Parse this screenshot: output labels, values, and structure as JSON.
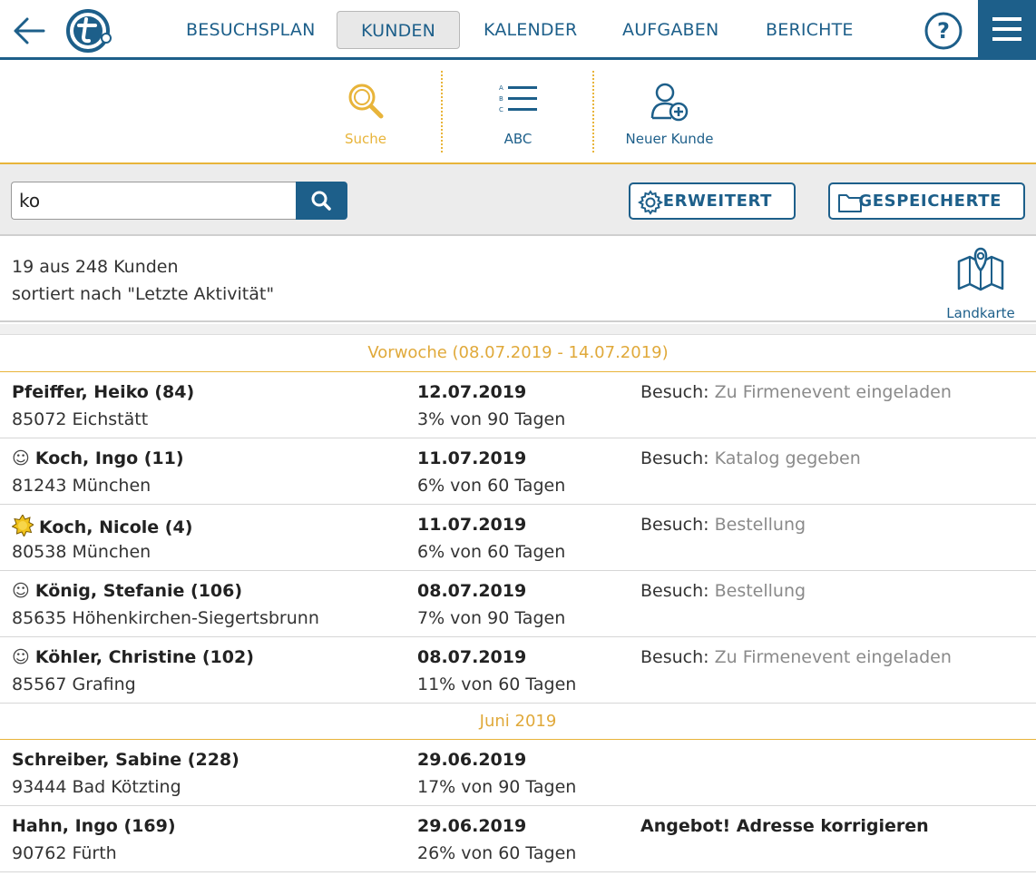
{
  "nav": {
    "items": [
      {
        "label": "BESUCHSPLAN"
      },
      {
        "label": "KUNDEN"
      },
      {
        "label": "KALENDER"
      },
      {
        "label": "AUFGABEN"
      },
      {
        "label": "BERICHTE"
      }
    ],
    "active": "KUNDEN"
  },
  "tools": {
    "search_label": "Suche",
    "abc_label": "ABC",
    "new_label": "Neuer Kunde"
  },
  "search": {
    "value": "ko",
    "advanced_label": "ERWEITERT",
    "saved_label": "GESPEICHERTE"
  },
  "summary": {
    "count_text": "19 aus 248 Kunden",
    "sort_text": "sortiert nach \"Letzte Aktivität\"",
    "map_label": "Landkarte"
  },
  "groups": [
    {
      "header": "Vorwoche (08.07.2019 - 14.07.2019)",
      "rows": [
        {
          "icon": "",
          "name": "Pfeiffer, Heiko (84)",
          "city": "85072 Eichstätt",
          "date": "12.07.2019",
          "ratio": "3% von 90 Tagen",
          "activity_type": "Besuch: ",
          "activity_detail": "Zu Firmenevent eingeladen"
        },
        {
          "icon": "☺",
          "name": "Koch, Ingo (11)",
          "city": "81243 München",
          "date": "11.07.2019",
          "ratio": "6% von 60 Tagen",
          "activity_type": "Besuch: ",
          "activity_detail": "Katalog gegeben"
        },
        {
          "icon": "sun",
          "name": "Koch, Nicole (4)",
          "city": "80538 München",
          "date": "11.07.2019",
          "ratio": "6% von 60 Tagen",
          "activity_type": "Besuch: ",
          "activity_detail": "Bestellung"
        },
        {
          "icon": "☺",
          "name": "König, Stefanie (106)",
          "city": "85635 Höhenkirchen-Siegertsbrunn",
          "date": "08.07.2019",
          "ratio": "7% von 90 Tagen",
          "activity_type": "Besuch: ",
          "activity_detail": "Bestellung"
        },
        {
          "icon": "☺",
          "name": "Köhler, Christine (102)",
          "city": "85567 Grafing",
          "date": "08.07.2019",
          "ratio": "11% von 60 Tagen",
          "activity_type": "Besuch: ",
          "activity_detail": "Zu Firmenevent eingeladen"
        }
      ]
    },
    {
      "header": "Juni 2019",
      "rows": [
        {
          "icon": "",
          "name": "Schreiber, Sabine (228)",
          "city": "93444 Bad Kötzting",
          "date": "29.06.2019",
          "ratio": "17% von 90 Tagen",
          "activity_type": "",
          "activity_detail": ""
        },
        {
          "icon": "",
          "name": "Hahn, Ingo (169)",
          "city": "90762 Fürth",
          "date": "29.06.2019",
          "ratio": "26% von 60 Tagen",
          "activity_type": "",
          "activity_detail": "",
          "activity_bold": "Angebot! Adresse korrigieren"
        }
      ]
    }
  ],
  "colors": {
    "primary": "#1d5f8a",
    "accent": "#e8b43a",
    "muted": "#8a8a8a"
  }
}
